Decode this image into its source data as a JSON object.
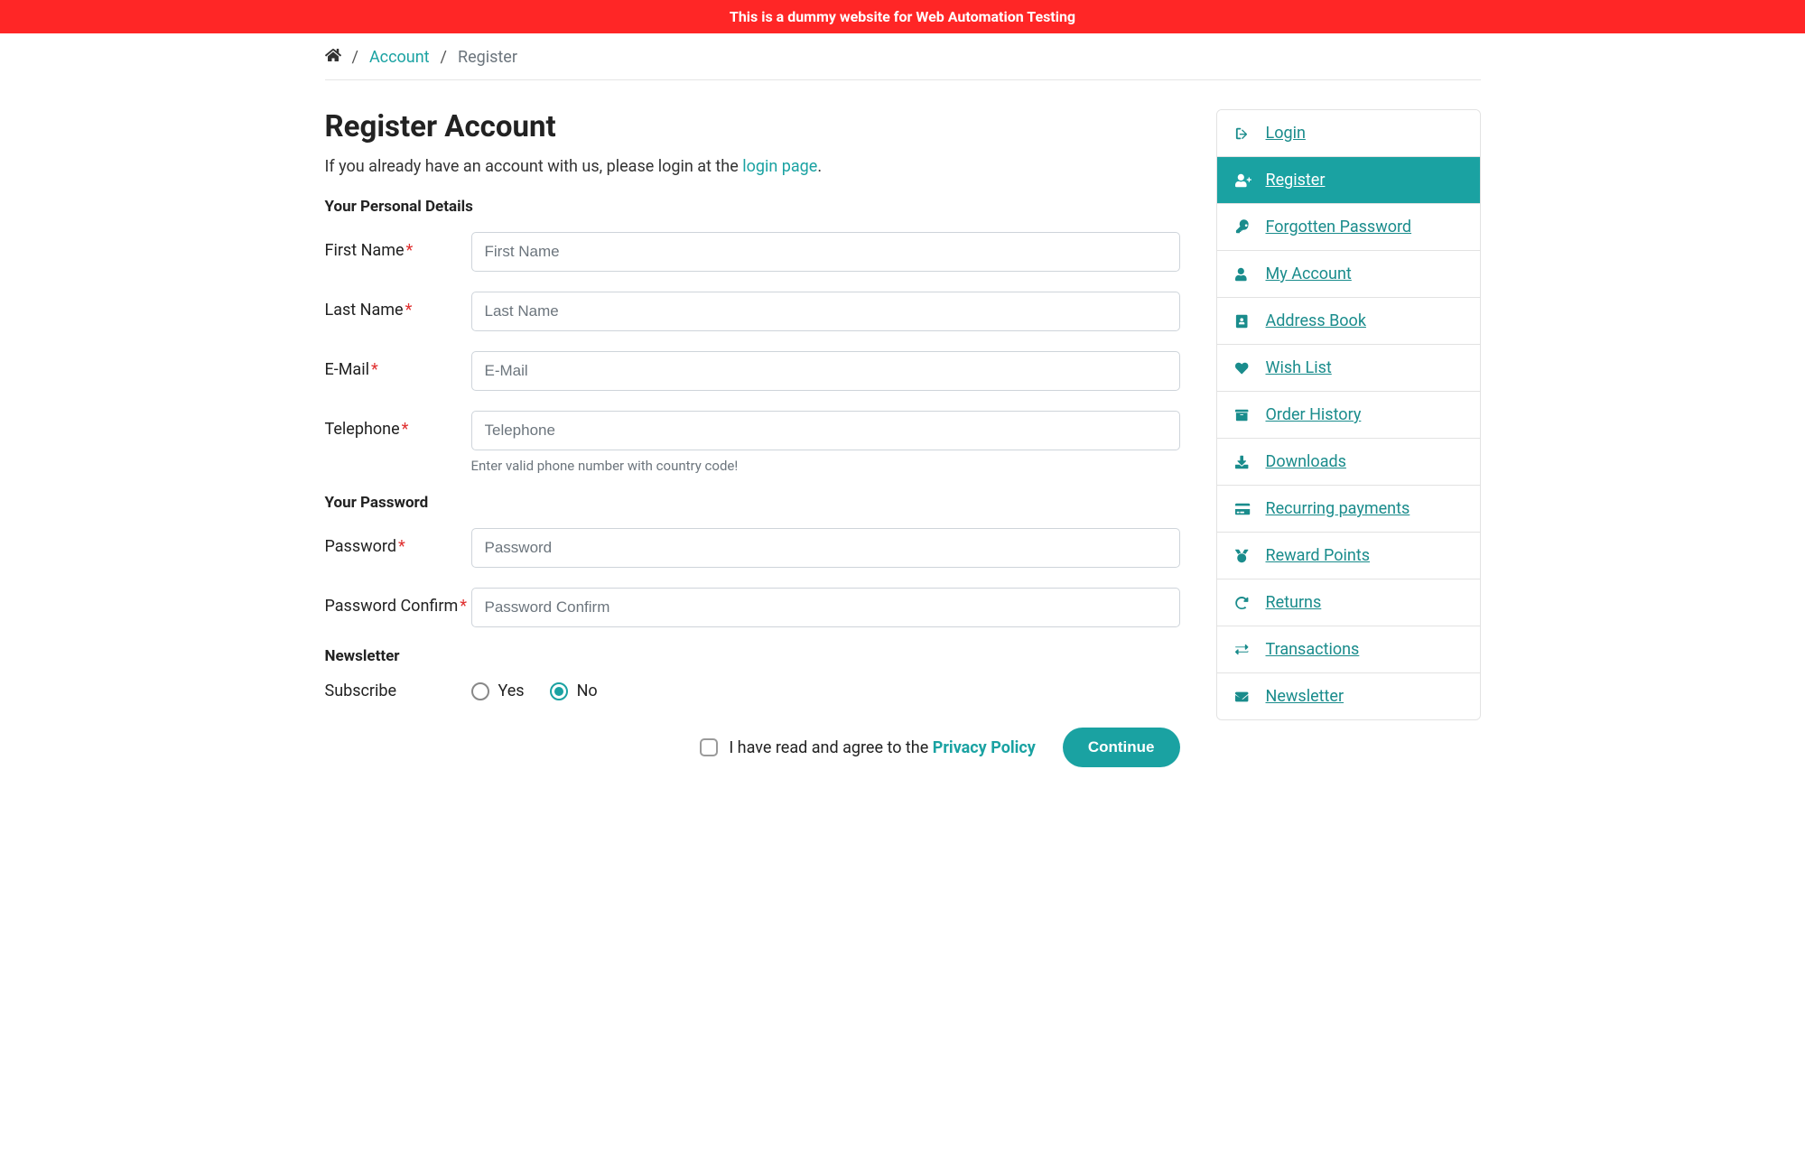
{
  "banner": {
    "text": "This is a dummy website for Web Automation Testing"
  },
  "breadcrumb": {
    "account": "Account",
    "current": "Register"
  },
  "page": {
    "title": "Register Account",
    "intro_prefix": "If you already have an account with us, please login at the ",
    "intro_link": "login page",
    "intro_suffix": "."
  },
  "sections": {
    "personal_legend": "Your Personal Details",
    "password_legend": "Your Password",
    "newsletter_legend": "Newsletter"
  },
  "fields": {
    "first_name": {
      "label": "First Name",
      "placeholder": "First Name",
      "required": true
    },
    "last_name": {
      "label": "Last Name",
      "placeholder": "Last Name",
      "required": true
    },
    "email": {
      "label": "E-Mail",
      "placeholder": "E-Mail",
      "required": true
    },
    "telephone": {
      "label": "Telephone",
      "placeholder": "Telephone",
      "required": true,
      "help": "Enter valid phone number with country code!"
    },
    "password": {
      "label": "Password",
      "placeholder": "Password",
      "required": true
    },
    "confirm": {
      "label": "Password Confirm",
      "placeholder": "Password Confirm",
      "required": true
    }
  },
  "newsletter": {
    "subscribe_label": "Subscribe",
    "yes": "Yes",
    "no": "No",
    "selected": "no"
  },
  "agree": {
    "prefix": "I have read and agree to the ",
    "link": "Privacy Policy"
  },
  "buttons": {
    "continue": "Continue"
  },
  "sidebar": {
    "items": [
      {
        "label": "Login",
        "icon": "login-icon"
      },
      {
        "label": "Register",
        "icon": "user-plus-icon",
        "active": true
      },
      {
        "label": "Forgotten Password",
        "icon": "key-icon"
      },
      {
        "label": "My Account",
        "icon": "user-icon"
      },
      {
        "label": "Address Book",
        "icon": "address-book-icon"
      },
      {
        "label": "Wish List",
        "icon": "heart-icon"
      },
      {
        "label": "Order History",
        "icon": "box-icon"
      },
      {
        "label": "Downloads",
        "icon": "download-icon"
      },
      {
        "label": "Recurring payments",
        "icon": "credit-card-icon"
      },
      {
        "label": "Reward Points",
        "icon": "medal-icon"
      },
      {
        "label": "Returns",
        "icon": "undo-icon"
      },
      {
        "label": "Transactions",
        "icon": "exchange-icon"
      },
      {
        "label": "Newsletter",
        "icon": "envelope-icon"
      }
    ]
  }
}
